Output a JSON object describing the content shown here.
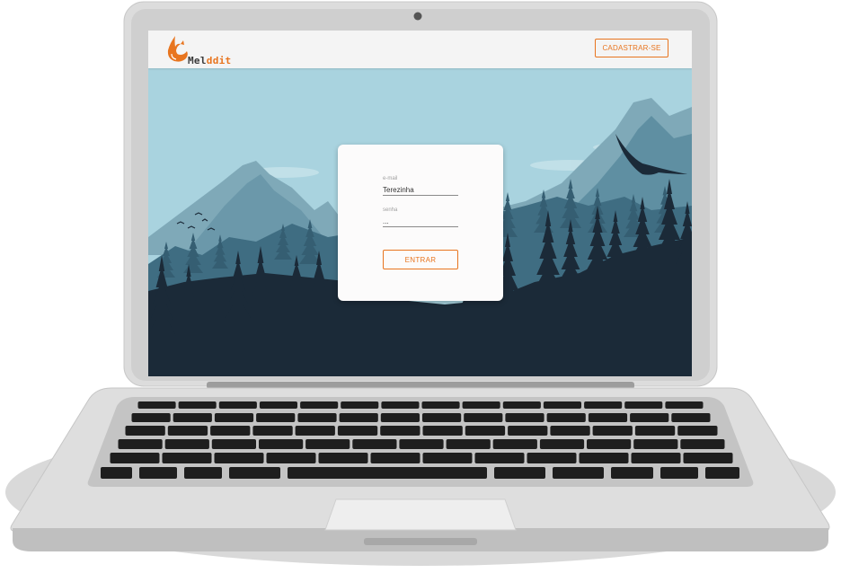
{
  "app": {
    "brand_prefix": "Mel",
    "brand_suffix": "ddit"
  },
  "header": {
    "signup_label": "CADASTRAR-SE"
  },
  "login": {
    "email_label": "e-mail",
    "email_value": "Terezinha",
    "password_label": "senha",
    "password_value": "...",
    "submit_label": "ENTRAR"
  },
  "colors": {
    "accent": "#e8751f",
    "sky": "#a9d3df",
    "forest_dark": "#1b2a38"
  },
  "icons": {
    "logo": "fox-flame-icon"
  }
}
